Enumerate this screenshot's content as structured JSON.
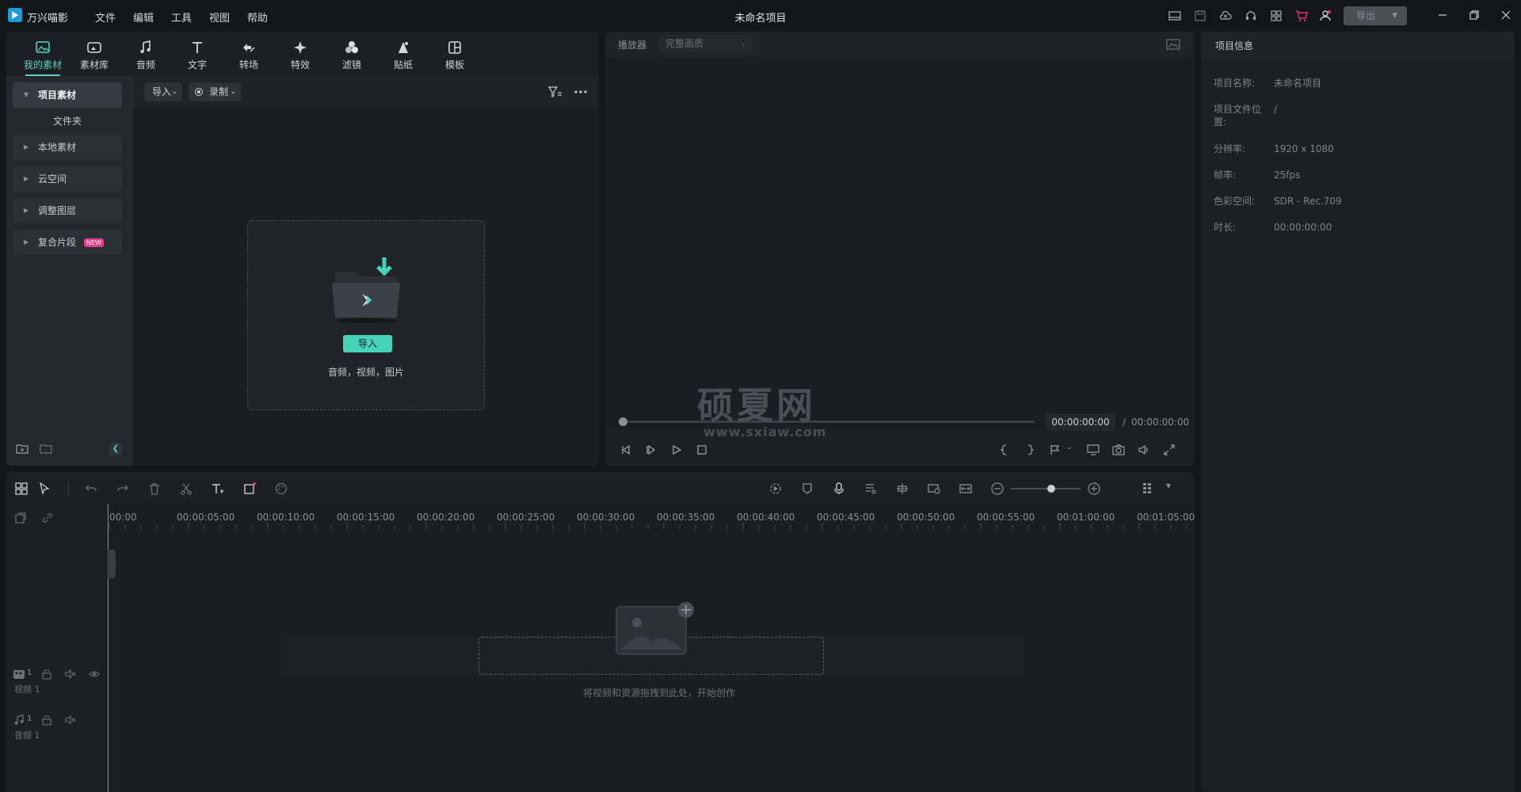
{
  "app": {
    "name": "万兴喵影",
    "window_title": "未命名项目"
  },
  "menu": [
    "文件",
    "编辑",
    "工具",
    "视图",
    "帮助"
  ],
  "export_button": {
    "label": "导出"
  },
  "media_tabs": [
    {
      "label": "我的素材",
      "icon": "image-icon"
    },
    {
      "label": "素材库",
      "icon": "cloud-image-icon"
    },
    {
      "label": "音频",
      "icon": "music-note-icon"
    },
    {
      "label": "文字",
      "icon": "text-t-icon"
    },
    {
      "label": "转场",
      "icon": "transition-arrows-icon"
    },
    {
      "label": "特效",
      "icon": "sparkle-effect-icon"
    },
    {
      "label": "滤镜",
      "icon": "filter-circles-icon"
    },
    {
      "label": "贴纸",
      "icon": "sticker-icon"
    },
    {
      "label": "模板",
      "icon": "template-grid-icon"
    }
  ],
  "media_sidebar": {
    "project_media": "项目素材",
    "folder": "文件夹",
    "local_media": "本地素材",
    "cloud_space": "云空间",
    "adjustment_layer": "调整图层",
    "compound_clip": "复合片段",
    "new_badge": "NEW"
  },
  "media_toolbar": {
    "import": "导入",
    "record": "录制"
  },
  "drop_zone": {
    "import_button": "导入",
    "hint": "音频，视频，图片"
  },
  "player": {
    "title": "播放器",
    "quality": "完整画质",
    "current_time": "00:00:00:00",
    "separator": "/",
    "total_time": "00:00:00:00"
  },
  "watermark": {
    "text": "硕夏网",
    "url": "www.sxiaw.com"
  },
  "info": {
    "title": "项目信息",
    "rows": [
      {
        "label": "项目名称:",
        "value": "未命名项目"
      },
      {
        "label": "项目文件位置:",
        "value": "/"
      },
      {
        "label": "分辨率:",
        "value": "1920 x 1080"
      },
      {
        "label": "帧率:",
        "value": "25fps"
      },
      {
        "label": "色彩空间:",
        "value": "SDR - Rec.709"
      },
      {
        "label": "时长:",
        "value": "00:00:00:00"
      }
    ]
  },
  "timeline": {
    "ruler": [
      "00:00",
      "00:00:05:00",
      "00:00:10:00",
      "00:00:15:00",
      "00:00:20:00",
      "00:00:25:00",
      "00:00:30:00",
      "00:00:35:00",
      "00:00:40:00",
      "00:00:45:00",
      "00:00:50:00",
      "00:00:55:00",
      "00:01:00:00",
      "00:01:05:00"
    ],
    "video_track": {
      "index": "1",
      "name": "视频 1"
    },
    "audio_track": {
      "index": "1",
      "name": "音频 1"
    },
    "drop_hint": "将视频和资源拖拽到此处，开始创作"
  },
  "colors": {
    "accent": "#47d3b8",
    "active_tab": "#5ad1c4",
    "badge": "#e53d8a",
    "background": "#14161a"
  }
}
